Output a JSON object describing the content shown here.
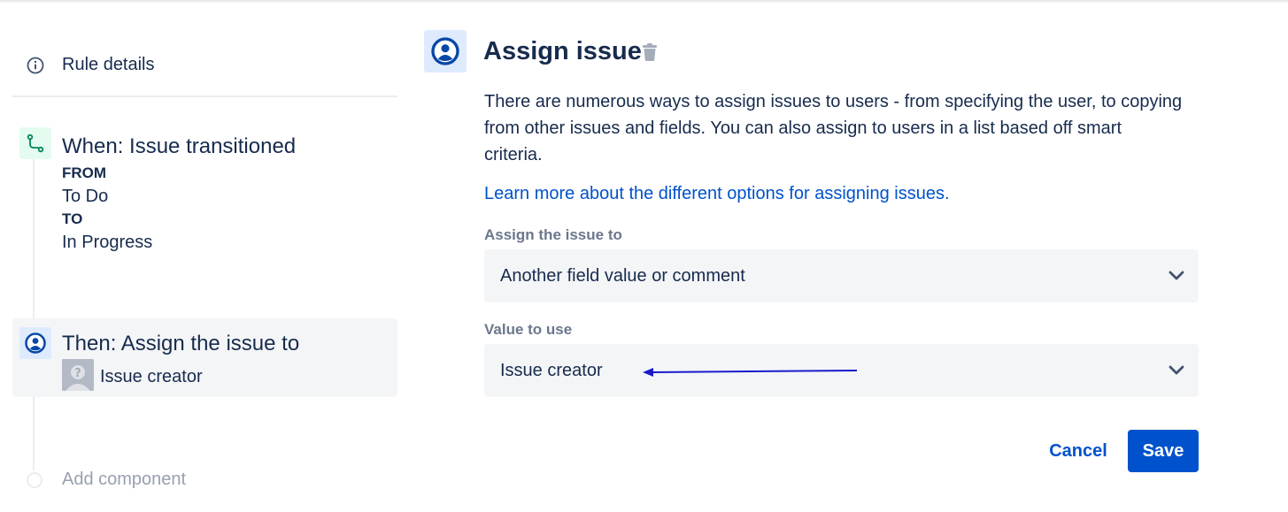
{
  "sidebar": {
    "rule_details": {
      "label": "Rule details",
      "icon": "info-icon"
    },
    "trigger": {
      "icon": "transition-icon",
      "title": "When: Issue transitioned",
      "from_label": "FROM",
      "from_value": "To Do",
      "to_label": "TO",
      "to_value": "In Progress"
    },
    "action": {
      "icon": "user-circle-icon",
      "title": "Then: Assign the issue to",
      "assignee": "Issue creator"
    },
    "add_component": {
      "label": "Add component"
    }
  },
  "panel": {
    "icon": "user-circle-icon",
    "title": "Assign issue",
    "description": "There are numerous ways to assign issues to users - from specifying the user, to copying from other issues and fields. You can also assign to users in a list based off smart criteria.",
    "learn_more": "Learn more about the different options for assigning issues.",
    "assign_to": {
      "label": "Assign the issue to",
      "value": "Another field value or comment"
    },
    "value_to_use": {
      "label": "Value to use",
      "value": "Issue creator"
    },
    "cancel_label": "Cancel",
    "save_label": "Save"
  },
  "colors": {
    "primary": "#0052cc",
    "text": "#172b4d",
    "subtle_text": "#6b778c",
    "field_bg": "#f4f5f7",
    "trigger_bg": "#e3fcef",
    "trigger_fg": "#00875a",
    "action_bg": "#deebff",
    "annotation_arrow": "#1a1acc"
  }
}
